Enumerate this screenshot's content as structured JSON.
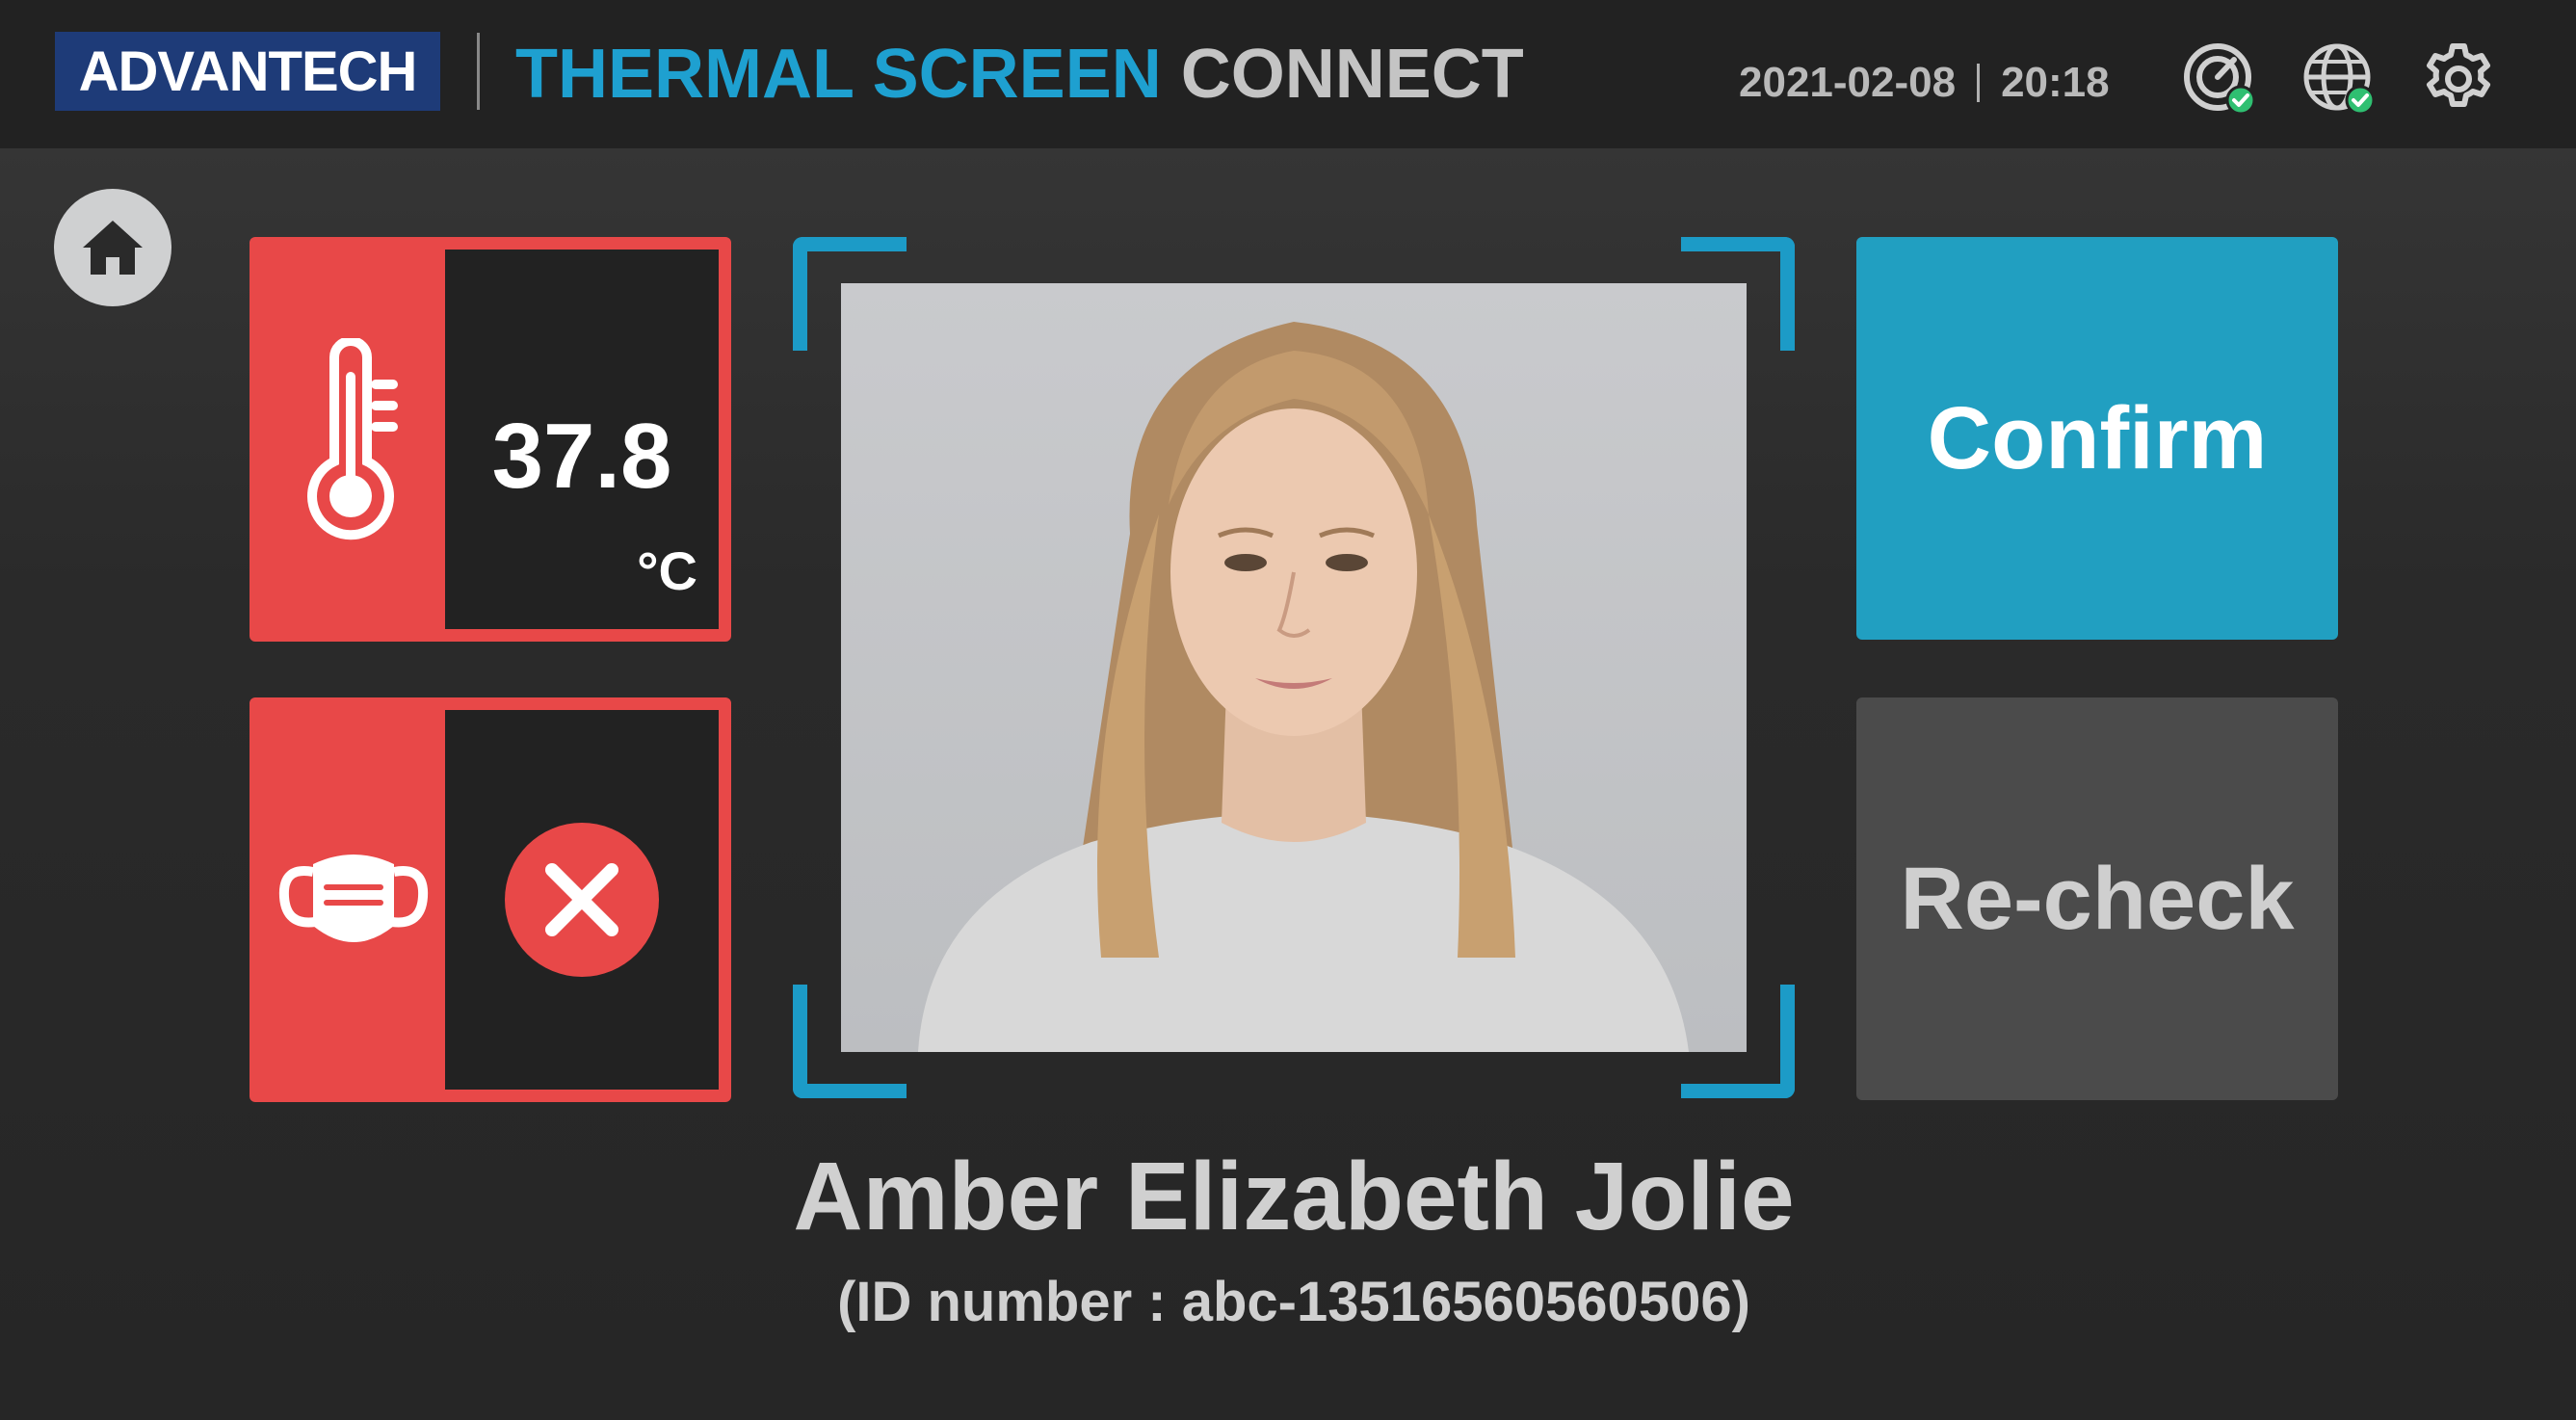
{
  "header": {
    "logo_text": "ADVANTECH",
    "title_part1": "THERMAL SCREEN",
    "title_part2": "CONNECT",
    "date": "2021-02-08",
    "time": "20:18",
    "icons": [
      "camera-status-icon",
      "network-status-icon",
      "settings-gear-icon"
    ]
  },
  "temperature": {
    "value": "37.8",
    "unit": "°C",
    "icon": "thermometer-icon"
  },
  "mask": {
    "icon": "face-mask-icon",
    "status_icon": "x-close-icon"
  },
  "person": {
    "name": "Amber Elizabeth Jolie",
    "id_text": "(ID number : abc-13516560560506)"
  },
  "actions": {
    "confirm_label": "Confirm",
    "recheck_label": "Re-check"
  },
  "colors": {
    "alert_red": "#e84848",
    "accent_blue": "#219fc1",
    "status_green": "#2fbf71"
  }
}
